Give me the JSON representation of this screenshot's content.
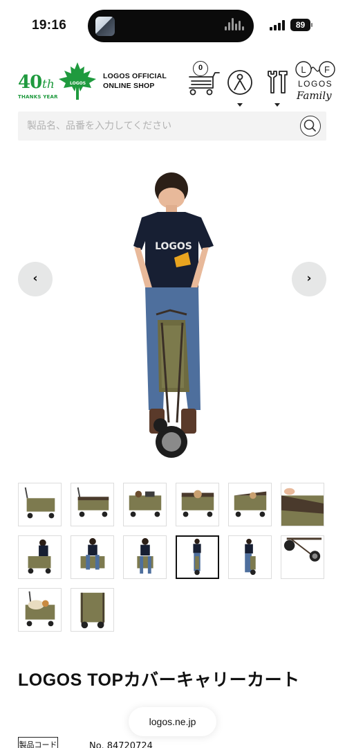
{
  "status_bar": {
    "time": "19:16",
    "battery": "89"
  },
  "header": {
    "logo_number": "40",
    "logo_suffix": "th",
    "logo_tagline": "THANKS YEAR",
    "logo_brand": "LOGOS",
    "shop_line1": "LOGOS OFFICIAL",
    "shop_line2": "ONLINE SHOP",
    "cart_count": "0",
    "family_letters_left": "L",
    "family_letters_right": "F",
    "family_brand": "LOGOS",
    "family_word": "Family",
    "brand_color": "#1f9a3e"
  },
  "search": {
    "placeholder": "製品名、品番を入力してください"
  },
  "gallery": {
    "prev_label": "‹",
    "next_label": "›",
    "active_index": 9
  },
  "product": {
    "title": "LOGOS TOPカバーキャリーカート",
    "code_label": "製品コード",
    "code_value": "No. 84720724"
  },
  "browser": {
    "url": "logos.ne.jp"
  }
}
